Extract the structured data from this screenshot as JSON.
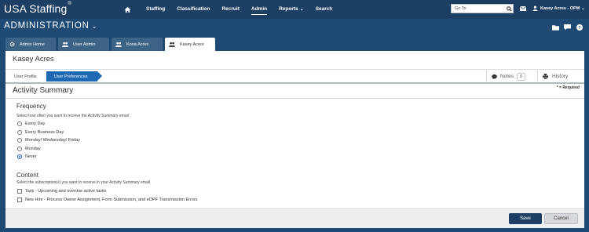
{
  "topbar": {
    "brand": "USA Staffing",
    "brand_mark": "®",
    "nav": [
      {
        "label": "Staffing"
      },
      {
        "label": "Classification"
      },
      {
        "label": "Recruit"
      },
      {
        "label": "Admin",
        "active": true
      },
      {
        "label": "Reports",
        "has_caret": true
      },
      {
        "label": "Search"
      }
    ],
    "goto_placeholder": "Go To",
    "user_label": "Kasey Acres - OPM"
  },
  "admin": {
    "title": "ADMINISTRATION",
    "icons": [
      "folder-icon",
      "chat-icon",
      "help-icon"
    ]
  },
  "tabs": [
    {
      "label": "Admin Home",
      "icon": "gear-icon"
    },
    {
      "label": "User Admin",
      "icon": "users-icon"
    },
    {
      "label": "Kona Acres",
      "icon": "users-icon"
    },
    {
      "label": "Kasey Acres",
      "icon": "users-icon",
      "active": true
    }
  ],
  "person_name": "Kasey Acres",
  "breadcrumbs": [
    {
      "label": "User Profile"
    },
    {
      "label": "User Preferences",
      "active": true
    }
  ],
  "notes": {
    "label": "Notes",
    "count": "0"
  },
  "history": {
    "label": "History"
  },
  "required_note": "* = Required",
  "section_title": "Activity Summary",
  "frequency": {
    "heading": "Frequency",
    "help": "Select how often you want to receive the Activity Summary email",
    "options": [
      {
        "label": "Every Day",
        "selected": false
      },
      {
        "label": "Every Business Day",
        "selected": false
      },
      {
        "label": "Monday/ Wednesday/ Friday",
        "selected": false
      },
      {
        "label": "Monday",
        "selected": false
      },
      {
        "label": "Never",
        "selected": true
      }
    ]
  },
  "content": {
    "heading": "Content",
    "help": "Select the subscription(s) you want to receive in your Activity Summary email",
    "options": [
      {
        "label": "Task - Upcoming and overdue active tasks",
        "checked": false
      },
      {
        "label": "New Hire - Process Owner Assignment, Form Submission, and eOPF Transmission Errors",
        "checked": false
      }
    ]
  },
  "buttons": {
    "save": "Save",
    "cancel": "Cancel"
  },
  "colors": {
    "nav_bg": "#1c3f63",
    "accent": "#1f68b3",
    "save_bg": "#1c3f63"
  }
}
